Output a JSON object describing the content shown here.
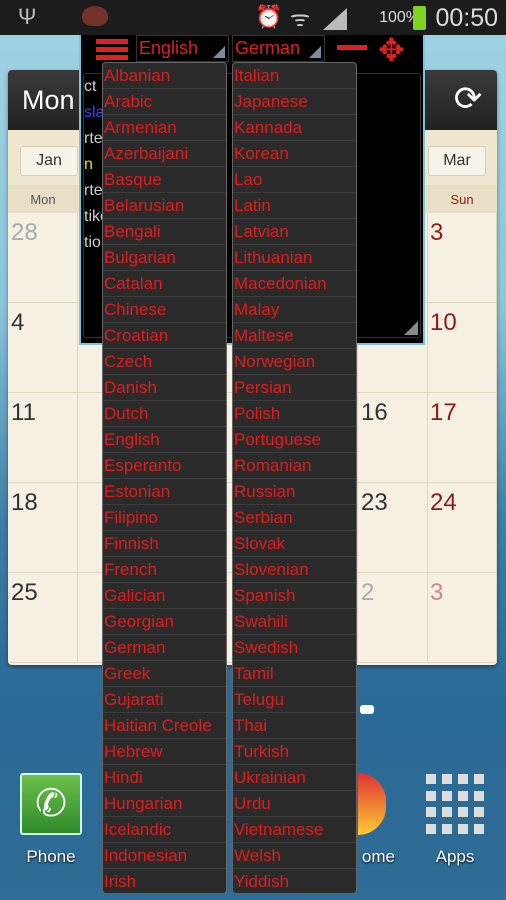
{
  "status_bar": {
    "time": "00:50",
    "battery": "100%"
  },
  "calendar": {
    "title": "Mon",
    "prev_month": "Jan",
    "next_month": "Mar",
    "day_headers": {
      "mon": "Mon",
      "sun": "Sun"
    },
    "weeks": [
      {
        "mon": "28",
        "sat": "",
        "sun": "3"
      },
      {
        "mon": "4",
        "sat": "",
        "sun": "10"
      },
      {
        "mon": "11",
        "sat": "16",
        "sun": "17"
      },
      {
        "mon": "18",
        "sat": "23",
        "sun": "24"
      },
      {
        "mon": "25",
        "sat": "2",
        "sun": "3"
      }
    ]
  },
  "translator": {
    "source_language": "English",
    "target_language": "German",
    "background_fragments": [
      "ct",
      "sla",
      "rte",
      "n",
      "rte",
      "tiko",
      "tior"
    ],
    "source_options": [
      "Albanian",
      "Arabic",
      "Armenian",
      "Azerbaijani",
      "Basque",
      "Belarusian",
      "Bengali",
      "Bulgarian",
      "Catalan",
      "Chinese",
      "Croatian",
      "Czech",
      "Danish",
      "Dutch",
      "English",
      "Esperanto",
      "Estonian",
      "Filipino",
      "Finnish",
      "French",
      "Galician",
      "Georgian",
      "German",
      "Greek",
      "Gujarati",
      "Haitian Creole",
      "Hebrew",
      "Hindi",
      "Hungarian",
      "Icelandic",
      "Indonesian",
      "Irish"
    ],
    "target_options": [
      "Italian",
      "Japanese",
      "Kannada",
      "Korean",
      "Lao",
      "Latin",
      "Latvian",
      "Lithuanian",
      "Macedonian",
      "Malay",
      "Maltese",
      "Norwegian",
      "Persian",
      "Polish",
      "Portuguese",
      "Romanian",
      "Russian",
      "Serbian",
      "Slovak",
      "Slovenian",
      "Spanish",
      "Swahili",
      "Swedish",
      "Tamil",
      "Telugu",
      "Thai",
      "Turkish",
      "Ukrainian",
      "Urdu",
      "Vietnamese",
      "Welsh",
      "Yiddish"
    ],
    "text_color": "#e01c1c"
  },
  "dock": {
    "phone": "Phone",
    "chrome": "ome",
    "apps": "Apps"
  }
}
